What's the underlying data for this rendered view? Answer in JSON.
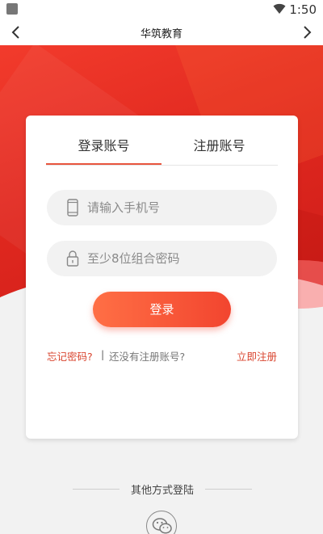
{
  "status_bar": {
    "time": "1:50"
  },
  "nav": {
    "title": "华筑教育"
  },
  "tabs": {
    "login": "登录账号",
    "register": "注册账号"
  },
  "form": {
    "phone_placeholder": "请输入手机号",
    "password_placeholder": "至少8位组合密码",
    "login_button": "登录"
  },
  "links": {
    "forgot": "忘记密码?",
    "separator": "|",
    "no_account": "还没有注册账号?",
    "register_now": "立即注册"
  },
  "other_login": {
    "label": "其他方式登陆"
  },
  "colors": {
    "accent": "#e8553e",
    "hero": "#e0281f",
    "button_start": "#ff6f45",
    "button_end": "#f2452f"
  }
}
